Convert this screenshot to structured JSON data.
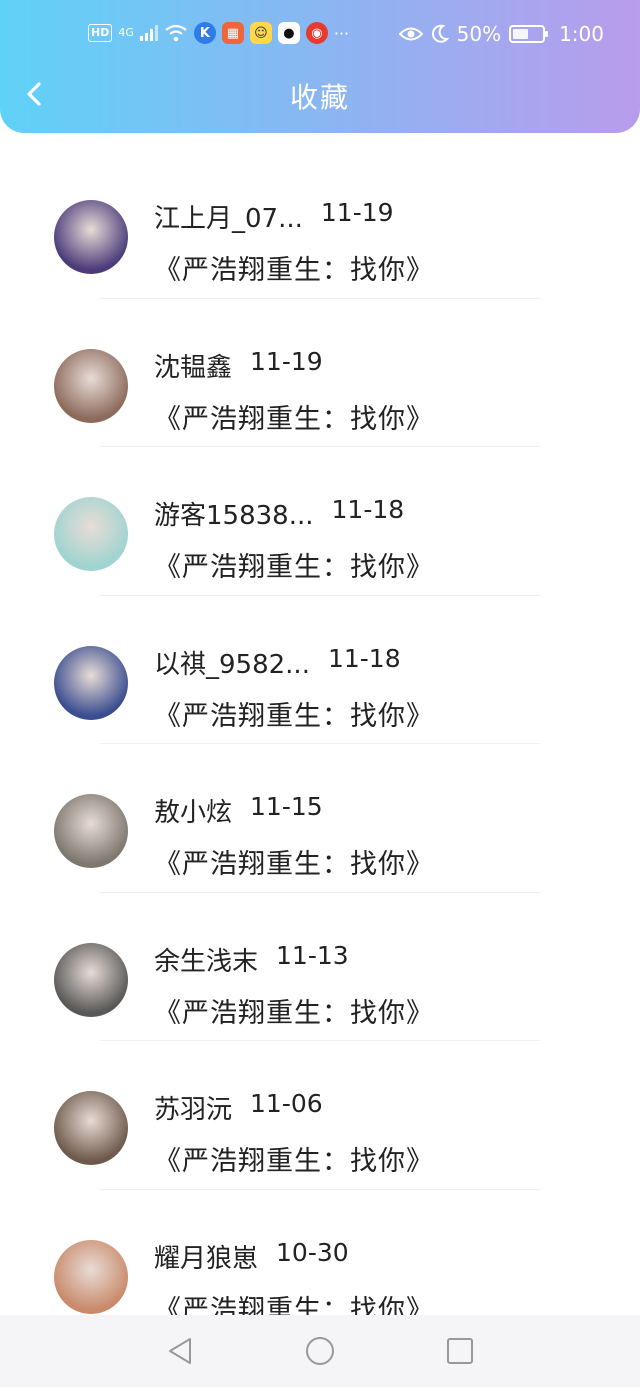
{
  "status_bar": {
    "hd": "HD",
    "signal": "4G",
    "more": "···",
    "battery": "50%",
    "time": "1:00"
  },
  "header": {
    "title": "收藏"
  },
  "items": [
    {
      "name": "江上月_07...",
      "date": "11-19",
      "book": "《严浩翔重生：找你》",
      "avatar_color": "#4b3b7a"
    },
    {
      "name": "沈韫鑫",
      "date": "11-19",
      "book": "《严浩翔重生：找你》",
      "avatar_color": "#8c6a5c"
    },
    {
      "name": "游客15838...",
      "date": "11-18",
      "book": "《严浩翔重生：找你》",
      "avatar_color": "#9fd4d0"
    },
    {
      "name": "以祺_9582...",
      "date": "11-18",
      "book": "《严浩翔重生：找你》",
      "avatar_color": "#3a4d8f"
    },
    {
      "name": "敖小炫",
      "date": "11-15",
      "book": "《严浩翔重生：找你》",
      "avatar_color": "#7d776e"
    },
    {
      "name": "余生浅末",
      "date": "11-13",
      "book": "《严浩翔重生：找你》",
      "avatar_color": "#585858"
    },
    {
      "name": "苏羽沅",
      "date": "11-06",
      "book": "《严浩翔重生：找你》",
      "avatar_color": "#6e5a4c"
    },
    {
      "name": "耀月狼崽",
      "date": "10-30",
      "book": "《严浩翔重生：找你》",
      "avatar_color": "#c98a6a"
    }
  ]
}
